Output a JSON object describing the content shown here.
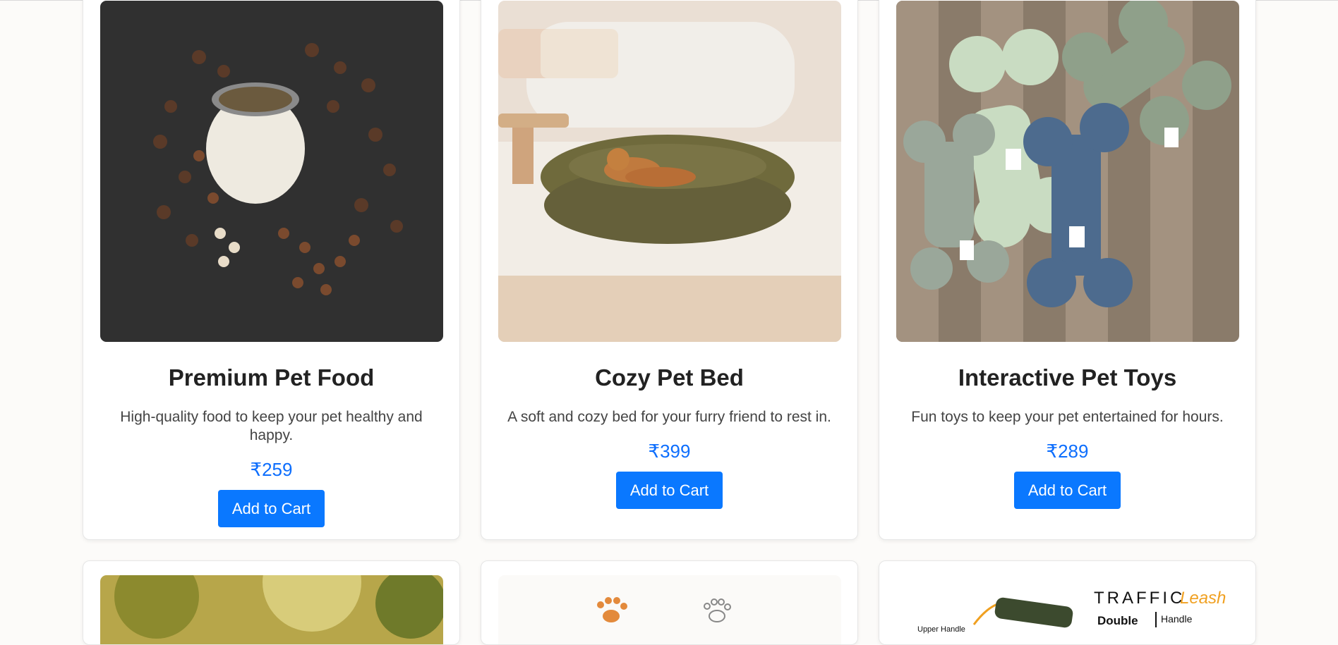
{
  "products": [
    {
      "name": "Premium Pet Food",
      "description": "High-quality food to keep your pet healthy and happy.",
      "price": "₹259",
      "button": "Add to Cart",
      "image": "pet-food-image"
    },
    {
      "name": "Cozy Pet Bed",
      "description": "A soft and cozy bed for your furry friend to rest in.",
      "price": "₹399",
      "button": "Add to Cart",
      "image": "pet-bed-image"
    },
    {
      "name": "Interactive Pet Toys",
      "description": "Fun toys to keep your pet entertained for hours.",
      "price": "₹289",
      "button": "Add to Cart",
      "image": "pet-toys-image"
    }
  ],
  "next_row": [
    {
      "image": "outdoor-pet-image"
    },
    {
      "image": "paw-print-image"
    },
    {
      "image": "traffic-leash-image",
      "image_text": "TRAFFIC",
      "image_text_accent": "Leash",
      "image_subtext": "Double",
      "image_subtext2": "Handle",
      "image_callout": "Upper Handle"
    }
  ],
  "colors": {
    "accent": "#0a78ff",
    "price": "#0d6efd",
    "background": "#fcfbf9"
  }
}
